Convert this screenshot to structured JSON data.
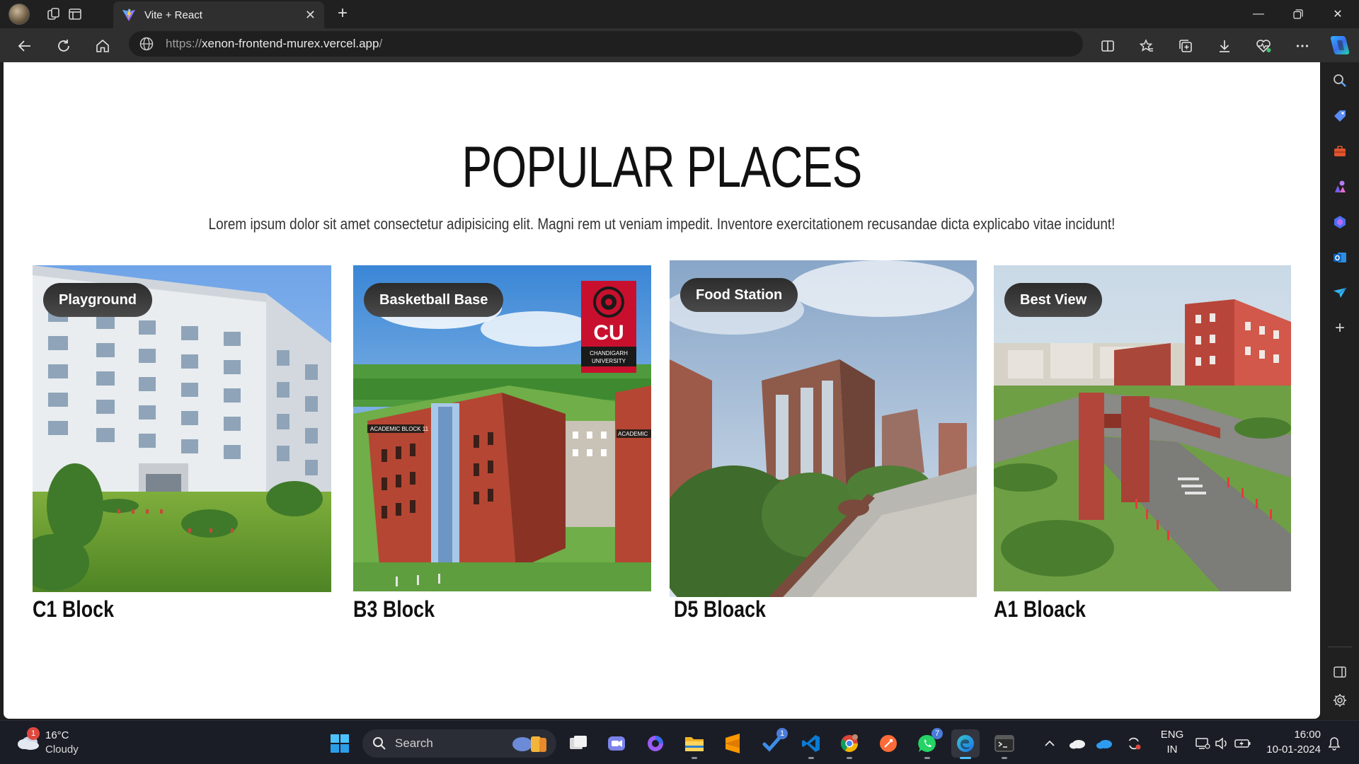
{
  "browser": {
    "tab_title": "Vite + React",
    "url": {
      "protocol": "https://",
      "host": "xenon-frontend-murex.vercel.app",
      "path": "/"
    }
  },
  "page": {
    "heading": "POPULAR PLACES",
    "intro": "Lorem ipsum dolor sit amet consectetur adipisicing elit. Magni rem ut veniam impedit. Inventore exercitationem recusandae dicta explicabo vitae incidunt!",
    "cards": [
      {
        "badge": "Playground",
        "title": "C1 Block"
      },
      {
        "badge": "Basketball Base",
        "title": "B3 Block"
      },
      {
        "badge": "Food Station",
        "title": "D5 Bloack"
      },
      {
        "badge": "Best View",
        "title": "A1 Bloack"
      }
    ],
    "photo_text": {
      "logo_letters": "CU",
      "logo_line1": "CHANDIGARH",
      "logo_line2": "UNIVERSITY",
      "sign_left": "ACADEMIC BLOCK 11",
      "sign_right": "ACADEMIC"
    }
  },
  "taskbar": {
    "weather_badge": "1",
    "weather_temp": "16°C",
    "weather_desc": "Cloudy",
    "search_placeholder": "Search",
    "badges": {
      "copilot_app": "1",
      "whatsapp": "7"
    },
    "language_line1": "ENG",
    "language_line2": "IN",
    "time": "16:00",
    "date": "10-01-2024"
  },
  "colors": {
    "page_background": "#ffffff",
    "browser_chrome": "#2f2f2f",
    "taskbar": "#1b1d26",
    "badge": "#3a3a3a",
    "accent": "#4cc2ff"
  }
}
